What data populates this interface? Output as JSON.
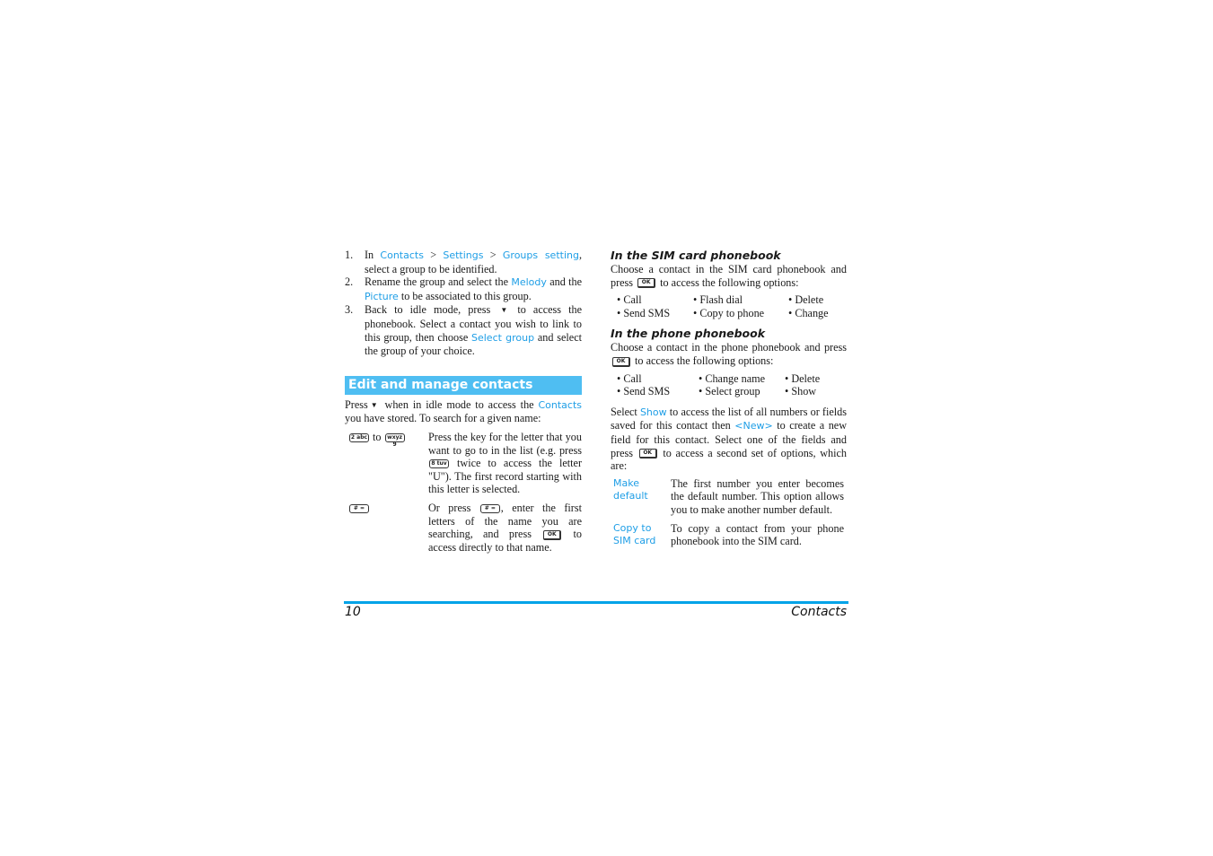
{
  "left_column": {
    "steps": [
      {
        "num": "1.",
        "parts": [
          "In ",
          {
            "hl": "Contacts"
          },
          " > ",
          {
            "hl": "Settings"
          },
          " > ",
          {
            "hl": "Groups setting"
          },
          ", select a group to be identified."
        ]
      },
      {
        "num": "2.",
        "parts": [
          "Rename the group and select the ",
          {
            "hl": "Melody"
          },
          " and the ",
          {
            "hl": "Picture"
          },
          " to be associated to this group."
        ]
      },
      {
        "num": "3.",
        "parts": [
          "Back to idle mode, press ",
          {
            "icon": "down"
          },
          " to access the phonebook. Select a contact you wish to link to this group, then choose ",
          {
            "hl": "Select group"
          },
          " and select the group of your choice."
        ]
      }
    ],
    "section_title": "Edit and manage contacts",
    "intro": {
      "press": "Press",
      "after_icon": " when in idle mode to access the ",
      "contacts_link": "Contacts",
      "rest": " you have stored. To search for a given name:"
    },
    "key_rows": [
      {
        "keys": {
          "from_key": "2 abc",
          "to_word": "to",
          "to_key": "wxyz 9"
        },
        "desc": {
          "a": "Press the key for the letter that you want to go to in the list (e.g. press",
          "key": "8 tuv",
          "b": "twice to access the letter \"U\"). The first record starting with this letter is selected."
        }
      },
      {
        "keys": {
          "key": "# ="
        },
        "desc": {
          "a": "Or press",
          "key": "# =",
          "b": ", enter the first letters of the name you are searching, and press",
          "ok": "OK",
          "c": "to access directly to that name."
        }
      }
    ]
  },
  "right_column": {
    "sim_heading": "In the SIM card phonebook",
    "sim_para": {
      "a": "Choose a contact in  the SIM card phonebook and press",
      "ok": "OK",
      "b": "to access the following options:"
    },
    "sim_options": [
      "Call",
      "Flash dial",
      "Delete",
      "Send SMS",
      "Copy to phone",
      "Change"
    ],
    "phone_heading": "In the phone phonebook",
    "phone_para": {
      "a": "Choose a contact in the phone phonebook and press",
      "ok": "OK",
      "b": "to access the following options:"
    },
    "phone_options": [
      "Call",
      "Change name",
      "Delete",
      "Send SMS",
      "Select group",
      "Show"
    ],
    "show_para": {
      "a": "Select ",
      "show": "Show",
      "b": " to access the list of all numbers or fields saved for this contact then ",
      "new": "<New>",
      "c": " to create a new field for this contact. Select one of the fields and press",
      "ok": "OK",
      "d": "to access a second set of options, which are:"
    },
    "definitions": [
      {
        "term": "Make default",
        "def": "The first number you enter becomes the default number. This option allows you to make another number default."
      },
      {
        "term": "Copy to SIM card",
        "def": "To copy a contact from your phone phonebook into the SIM card."
      }
    ]
  },
  "footer": {
    "page_number": "10",
    "chapter": "Contacts"
  },
  "colors": {
    "accent": "#1e9ee6",
    "section_bar": "#4fbef2",
    "footer_rule": "#00a3e8"
  }
}
